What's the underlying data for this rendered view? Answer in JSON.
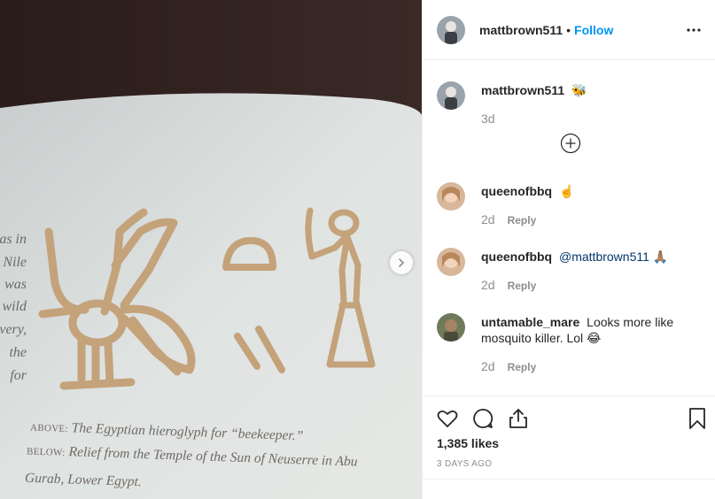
{
  "post": {
    "author": "mattbrown511",
    "separator": "•",
    "follow_label": "Follow",
    "photo": {
      "body_fragments": [
        "eas in",
        "Nile",
        "was",
        "wild",
        "very,",
        "the",
        "for"
      ],
      "caption_above_tag": "ABOVE:",
      "caption_above": "The Egyptian hieroglyph for “beekeeper.”",
      "caption_below_tag": "BELOW:",
      "caption_below_1": "Relief from the Temple of the Sun of Neuserre in Abu",
      "caption_below_2": "Gurab, Lower Egypt."
    }
  },
  "caption": {
    "username": "mattbrown511",
    "text": "🐝",
    "age": "3d"
  },
  "comments": [
    {
      "username": "queenofbbq",
      "mention": "",
      "text": "☝️",
      "age": "2d",
      "reply": "Reply"
    },
    {
      "username": "queenofbbq",
      "mention": "@mattbrown511",
      "text": "🙏🏽",
      "age": "2d",
      "reply": "Reply"
    },
    {
      "username": "untamable_mare",
      "mention": "",
      "text": "Looks more like mosquito killer. Lol 😂",
      "age": "2d",
      "reply": "Reply"
    }
  ],
  "stats": {
    "likes": "1,385 likes",
    "posted": "3 DAYS AGO"
  },
  "icons": {
    "more": "more-options-icon",
    "load_more": "plus-circle-icon",
    "like": "heart-icon",
    "comment": "comment-bubble-icon",
    "share": "share-icon",
    "save": "bookmark-icon",
    "next": "chevron-right-icon"
  },
  "colors": {
    "accent": "#0095f6",
    "mention": "#00376b",
    "muted": "#8e8e8e",
    "text": "#262626",
    "ink": "#c4a27a"
  }
}
